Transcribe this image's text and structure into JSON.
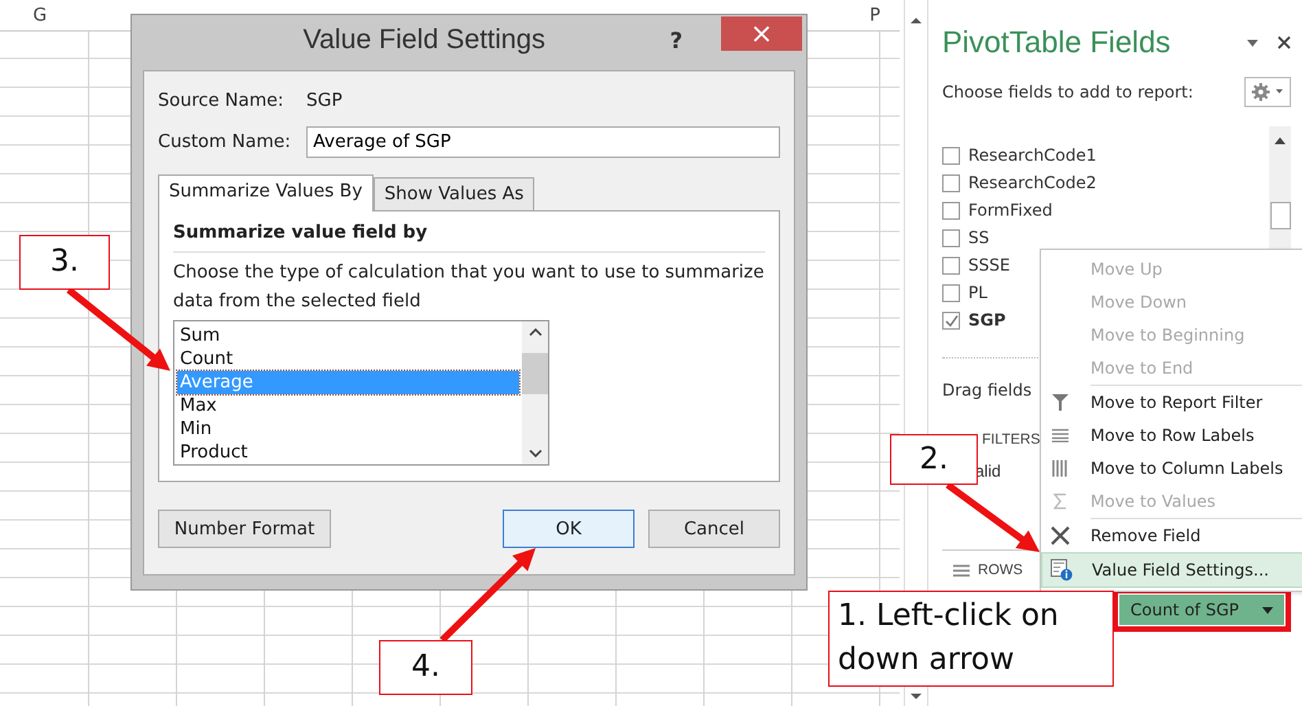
{
  "sheet": {
    "columns": [
      {
        "label": "G"
      },
      {
        "label": "P"
      }
    ]
  },
  "dialog": {
    "title": "Value Field Settings",
    "help": "?",
    "close": "×",
    "source_label": "Source Name:",
    "source_value": "SGP",
    "custom_label": "Custom Name:",
    "custom_value": "Average of SGP",
    "tabs": [
      {
        "label": "Summarize Values By",
        "selected": true
      },
      {
        "label": "Show Values As",
        "selected": false
      }
    ],
    "heading": "Summarize value field by",
    "description": "Choose the type of calculation that you want to use to summarize data from the selected field",
    "functions": [
      {
        "label": "Sum",
        "selected": false
      },
      {
        "label": "Count",
        "selected": false
      },
      {
        "label": "Average",
        "selected": true
      },
      {
        "label": "Max",
        "selected": false
      },
      {
        "label": "Min",
        "selected": false
      },
      {
        "label": "Product",
        "selected": false
      }
    ],
    "buttons": [
      {
        "label": "Number Format",
        "kind": "secondary"
      },
      {
        "label": "OK",
        "kind": "default"
      },
      {
        "label": "Cancel",
        "kind": "plain"
      }
    ]
  },
  "pane": {
    "title": "PivotTable Fields",
    "prompt": "Choose fields to add to report:",
    "fields": [
      {
        "label": "ResearchCode1",
        "checked": false
      },
      {
        "label": "ResearchCode2",
        "checked": false
      },
      {
        "label": "FormFixed",
        "checked": false
      },
      {
        "label": "SS",
        "checked": false
      },
      {
        "label": "SSSE",
        "checked": false
      },
      {
        "label": "PL",
        "checked": false
      },
      {
        "label": "SGP",
        "checked": true
      }
    ],
    "drag_hint": "Drag fields",
    "filters_label": "FILTERS",
    "filter_item": "alid",
    "rows_label": "ROWS",
    "value_chip": "Count of SGP"
  },
  "menu": [
    {
      "label": "Move Up",
      "kind": "plain",
      "disabled": true,
      "highlighted": false
    },
    {
      "label": "Move Down",
      "kind": "plain",
      "disabled": true,
      "highlighted": false
    },
    {
      "label": "Move to Beginning",
      "kind": "plain",
      "disabled": true,
      "highlighted": false
    },
    {
      "label": "Move to End",
      "kind": "plain",
      "disabled": true,
      "highlighted": false
    },
    {
      "label": "Move to Report Filter",
      "kind": "filter",
      "disabled": false,
      "highlighted": false
    },
    {
      "label": "Move to Row Labels",
      "kind": "rows",
      "disabled": false,
      "highlighted": false
    },
    {
      "label": "Move to Column Labels",
      "kind": "columns",
      "disabled": false,
      "highlighted": false
    },
    {
      "label": "Move to Values",
      "kind": "sum",
      "disabled": true,
      "highlighted": false
    },
    {
      "label": "Remove Field",
      "kind": "remove",
      "disabled": false,
      "highlighted": false
    },
    {
      "label": "Value Field Settings...",
      "kind": "settings",
      "disabled": false,
      "highlighted": true
    }
  ],
  "callouts": [
    {
      "text": "3."
    },
    {
      "text": "2."
    },
    {
      "text": "4."
    },
    {
      "text": "1. Left-click on down arrow"
    }
  ]
}
